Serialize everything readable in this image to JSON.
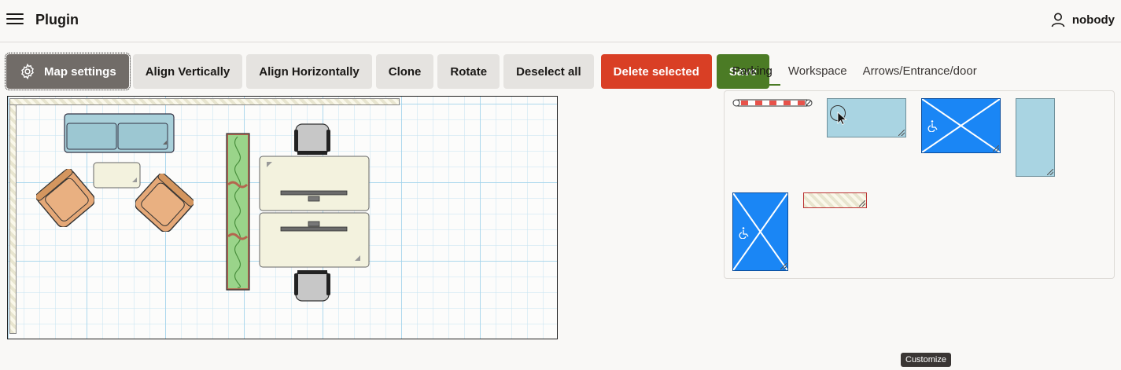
{
  "header": {
    "title": "Plugin",
    "user_name": "nobody"
  },
  "toolbar": {
    "map_settings": "Map settings",
    "align_vertically": "Align Vertically",
    "align_horizontally": "Align Horizontally",
    "clone": "Clone",
    "rotate": "Rotate",
    "deselect_all": "Deselect all",
    "delete_selected": "Delete selected",
    "save": "Save"
  },
  "tabs": [
    {
      "label": "Parking",
      "active": true
    },
    {
      "label": "Workspace",
      "active": false
    },
    {
      "label": "Arrows/Entrance/door",
      "active": false
    }
  ],
  "tooltip": "Customize",
  "colors": {
    "delete": "#d93f25",
    "save": "#4b7b25",
    "map_settings": "#716c68",
    "parking_blue": "#1a86f5",
    "parking_light": "#a9d4e2"
  },
  "icons": {
    "menu": "hamburger-icon",
    "user": "user-icon",
    "settings": "gear-icon",
    "accessible": "wheelchair-icon"
  }
}
